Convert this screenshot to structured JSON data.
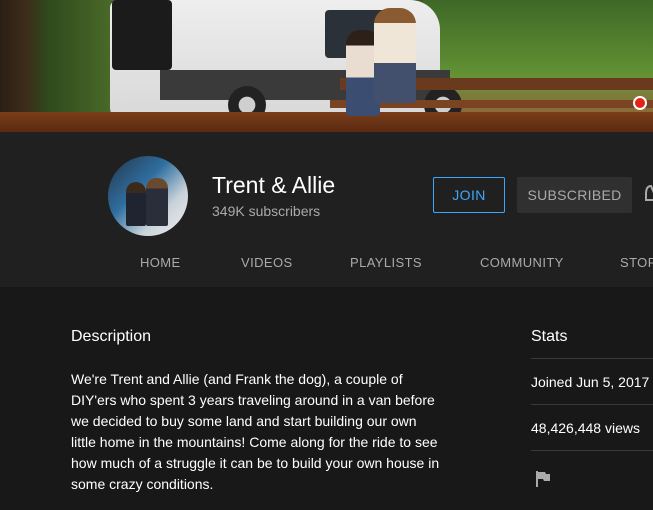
{
  "channel": {
    "name": "Trent & Allie",
    "subscribers": "349K subscribers"
  },
  "buttons": {
    "join": "JOIN",
    "subscribed": "SUBSCRIBED"
  },
  "tabs": [
    "HOME",
    "VIDEOS",
    "PLAYLISTS",
    "COMMUNITY",
    "STOR"
  ],
  "about": {
    "description_title": "Description",
    "description": "We're Trent and Allie (and Frank the dog), a couple of DIY'ers who spent 3 years traveling around in a van before we decided to buy some land and start building our own little home in the mountains! Come along for the ride to see how much of a struggle it can be to build your own house in some crazy conditions."
  },
  "stats": {
    "title": "Stats",
    "joined": "Joined Jun 5, 2017",
    "views": "48,426,448 views"
  },
  "icons": {
    "notification": "bell-icon",
    "report": "flag-icon"
  },
  "colors": {
    "accent_blue": "#3ea6ff",
    "header_bg": "#202020",
    "page_bg": "#181818",
    "secondary_text": "#aaaaaa"
  }
}
